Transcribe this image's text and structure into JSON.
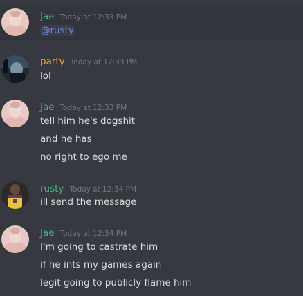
{
  "colors": {
    "background": "#36393f",
    "highlight_background": "#32353b",
    "text": "#dcddde",
    "timestamp": "#72767d",
    "jae_color": "#43b581",
    "party_color": "#faa61a",
    "rusty_color": "#43b581",
    "mention_color": "#7289da"
  },
  "messages": [
    {
      "author": "Jae",
      "timestamp": "Today at 12:33 PM",
      "avatar_icon": "jae-avatar",
      "lines": [
        "@rusty"
      ]
    },
    {
      "author": "party",
      "timestamp": "Today at 12:33 PM",
      "avatar_icon": "party-avatar",
      "lines": [
        "lol"
      ]
    },
    {
      "author": "Jae",
      "timestamp": "Today at 12:33 PM",
      "avatar_icon": "jae-avatar",
      "lines": [
        "tell him he's dogshit",
        "and he has",
        "no right to ego me"
      ]
    },
    {
      "author": "rusty",
      "timestamp": "Today at 12:34 PM",
      "avatar_icon": "rusty-avatar",
      "lines": [
        "ill send the message"
      ]
    },
    {
      "author": "Jae",
      "timestamp": "Today at 12:34 PM",
      "avatar_icon": "jae-avatar",
      "lines": [
        "I'm going to castrate him",
        "if he ints my games again",
        "legit going to publicly flame him"
      ]
    }
  ]
}
